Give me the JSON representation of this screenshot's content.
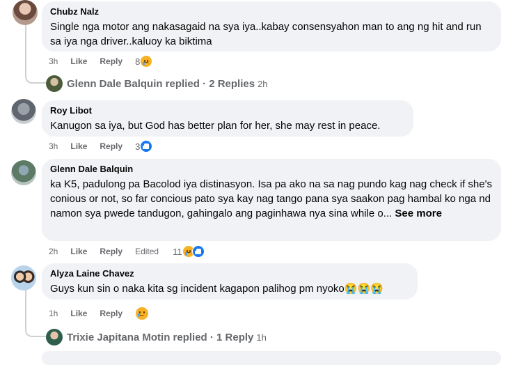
{
  "comments": [
    {
      "author": "Chubz Nalz",
      "text": "Single nga motor ang nakasagaid na sya iya..kabay consensyahon man to ang ng hit and run sa iya nga driver..kaluoy ka biktima",
      "time": "3h",
      "like_label": "Like",
      "reply_label": "Reply",
      "reaction_count": "8"
    },
    {
      "author": "Roy Libot",
      "text": "Kanugon sa iya, but God has better plan for her, she may rest in peace.",
      "time": "3h",
      "like_label": "Like",
      "reply_label": "Reply",
      "reaction_count": "3"
    },
    {
      "author": "Glenn Dale Balquin",
      "text": "ka K5, padulong pa Bacolod iya distinasyon. Isa pa ako na sa nag pundo kag nag check if she's conious or not, so far concious pato sya kay nag tango pana sya saakon pag hambal ko nga nd namon sya pwede tandugon, gahingalo ang paginhawa nya sina while o...",
      "see_more": "See more",
      "time": "2h",
      "like_label": "Like",
      "reply_label": "Reply",
      "edited_label": "Edited",
      "reaction_count": "11"
    },
    {
      "author": "Alyza Laine Chavez",
      "text": "Guys kun sin o naka kita sg incident kagapon palihog pm nyoko😭😭😭",
      "time": "1h",
      "like_label": "Like",
      "reply_label": "Reply",
      "reaction_count": ""
    }
  ],
  "reply_summaries": [
    {
      "text": "Glenn Dale Balquin replied · 2 Replies",
      "time": "2h"
    },
    {
      "text": "Trixie Japitana Motin replied · 1 Reply",
      "time": "1h"
    }
  ],
  "colors": {
    "bubble": "#f0f2f5",
    "meta": "#65676b",
    "like_blue": "#1877f2",
    "emoji_yellow": "#f7b125"
  }
}
